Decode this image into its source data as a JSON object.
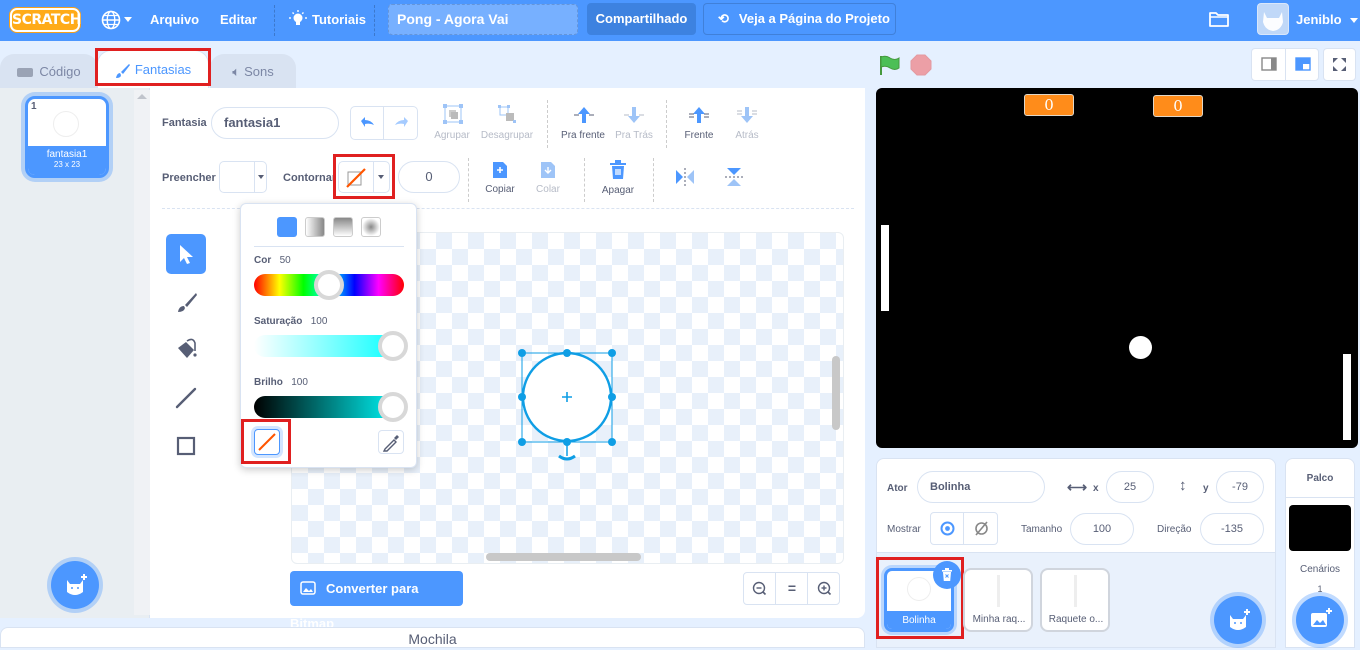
{
  "menubar": {
    "logo": "SCRATCH",
    "file_menu": "Arquivo",
    "edit_menu": "Editar",
    "tutorials": "Tutoriais",
    "project_title": "Pong - Agora Vai",
    "share_button": "Compartilhado",
    "project_page_button": "Veja a Página do Projeto",
    "username": "Jeniblo"
  },
  "tabs": [
    {
      "label": "Código",
      "icon": "code-icon"
    },
    {
      "label": "Fantasias",
      "icon": "paintbrush-icon",
      "active": true
    },
    {
      "label": "Sons",
      "icon": "speaker-icon"
    }
  ],
  "costume_list": {
    "items": [
      {
        "index": "1",
        "name": "fantasia1",
        "size": "23 x 23",
        "selected": true
      }
    ]
  },
  "paint_editor": {
    "costume_label": "Fantasia",
    "costume_name": "fantasia1",
    "group": "Agrupar",
    "ungroup": "Desagrupar",
    "forward": "Pra frente",
    "backward": "Pra Trás",
    "front": "Frente",
    "back": "Atrás",
    "fill_label": "Preencher",
    "outline_label": "Contornar",
    "outline_width": "0",
    "copy": "Copiar",
    "paste": "Colar",
    "delete": "Apagar",
    "convert_button": "Converter para Bitmap",
    "zoom_reset": "="
  },
  "color_picker": {
    "color_label": "Cor",
    "color_value": "50",
    "saturation_label": "Saturação",
    "saturation_value": "100",
    "brightness_label": "Brilho",
    "brightness_value": "100",
    "color_fraction": 0.5,
    "saturation_fraction": 1.0,
    "brightness_fraction": 1.0
  },
  "stage": {
    "score_left": "0",
    "score_right": "0"
  },
  "sprite_info": {
    "sprite_label": "Ator",
    "sprite_name": "Bolinha",
    "x_label": "x",
    "x_value": "25",
    "y_label": "y",
    "y_value": "-79",
    "show_label": "Mostrar",
    "size_label": "Tamanho",
    "size_value": "100",
    "direction_label": "Direção",
    "direction_value": "-135"
  },
  "sprites": [
    {
      "name": "Bolinha",
      "selected": true
    },
    {
      "name": "Minha raq..."
    },
    {
      "name": "Raquete o..."
    }
  ],
  "stage_panel": {
    "title": "Palco",
    "backdrops_label": "Cenários",
    "backdrops_count": "1"
  },
  "backpack": {
    "label": "Mochila"
  },
  "colors": {
    "brand_blue": "#4c97ff",
    "highlight_red": "#e02020",
    "score_orange": "#ff8c1a",
    "outline_none_slash": "#ff5500"
  }
}
